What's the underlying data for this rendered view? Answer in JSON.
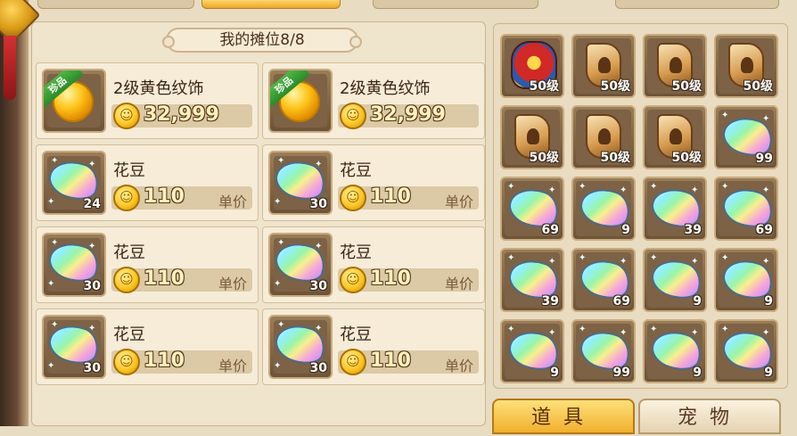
{
  "stall": {
    "title": "我的摊位8/8",
    "slots": [
      {
        "name": "2级黄色纹饰",
        "price": "32,999",
        "qty": "",
        "rare_label": "珍品",
        "unit_label": "",
        "icon": "yellow-gem-icon"
      },
      {
        "name": "2级黄色纹饰",
        "price": "32,999",
        "qty": "",
        "rare_label": "珍品",
        "unit_label": "",
        "icon": "yellow-gem-icon"
      },
      {
        "name": "花豆",
        "price": "110",
        "qty": "24",
        "rare_label": "",
        "unit_label": "单价",
        "icon": "rainbow-bean-icon"
      },
      {
        "name": "花豆",
        "price": "110",
        "qty": "30",
        "rare_label": "",
        "unit_label": "单价",
        "icon": "rainbow-bean-icon"
      },
      {
        "name": "花豆",
        "price": "110",
        "qty": "30",
        "rare_label": "",
        "unit_label": "单价",
        "icon": "rainbow-bean-icon"
      },
      {
        "name": "花豆",
        "price": "110",
        "qty": "30",
        "rare_label": "",
        "unit_label": "单价",
        "icon": "rainbow-bean-icon"
      },
      {
        "name": "花豆",
        "price": "110",
        "qty": "30",
        "rare_label": "",
        "unit_label": "单价",
        "icon": "rainbow-bean-icon"
      },
      {
        "name": "花豆",
        "price": "110",
        "qty": "30",
        "rare_label": "",
        "unit_label": "单价",
        "icon": "rainbow-bean-icon"
      }
    ],
    "coin_glyph": "☺"
  },
  "bag": {
    "items": [
      {
        "icon": "armor-icon",
        "qty": "50级"
      },
      {
        "icon": "scroll-icon",
        "qty": "50级"
      },
      {
        "icon": "scroll-icon",
        "qty": "50级"
      },
      {
        "icon": "scroll-icon",
        "qty": "50级"
      },
      {
        "icon": "scroll-icon",
        "qty": "50级"
      },
      {
        "icon": "scroll-icon",
        "qty": "50级"
      },
      {
        "icon": "scroll-icon",
        "qty": "50级"
      },
      {
        "icon": "rainbow-bean-icon",
        "qty": "99"
      },
      {
        "icon": "rainbow-bean-icon",
        "qty": "69"
      },
      {
        "icon": "rainbow-bean-icon",
        "qty": "9"
      },
      {
        "icon": "rainbow-bean-icon",
        "qty": "39"
      },
      {
        "icon": "rainbow-bean-icon",
        "qty": "69"
      },
      {
        "icon": "rainbow-bean-icon",
        "qty": "39"
      },
      {
        "icon": "rainbow-bean-icon",
        "qty": "69"
      },
      {
        "icon": "rainbow-bean-icon",
        "qty": "9"
      },
      {
        "icon": "rainbow-bean-icon",
        "qty": "9"
      },
      {
        "icon": "rainbow-bean-icon",
        "qty": "9"
      },
      {
        "icon": "rainbow-bean-icon",
        "qty": "99"
      },
      {
        "icon": "rainbow-bean-icon",
        "qty": "9"
      },
      {
        "icon": "rainbow-bean-icon",
        "qty": "9"
      }
    ]
  },
  "tabs": {
    "items_label": "道具",
    "pets_label": "宠物"
  }
}
